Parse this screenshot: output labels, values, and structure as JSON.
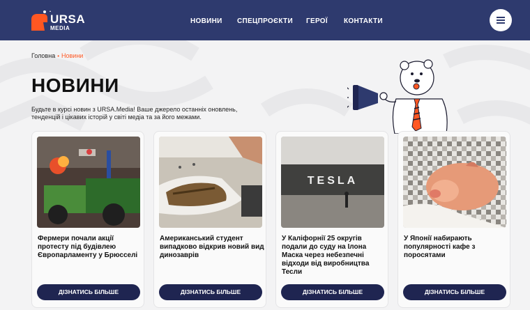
{
  "header": {
    "logo_text": "URSA",
    "logo_sub": "MEDIA",
    "nav": [
      "НОВИНИ",
      "СПЕЦПРОЄКТИ",
      "ГЕРОЇ",
      "КОНТАКТИ"
    ]
  },
  "breadcrumb": {
    "home": "Головна",
    "separator": "•",
    "current": "Новини"
  },
  "page": {
    "title": "НОВИНИ",
    "intro": "Будьте в курсі новин з URSA.Media! Ваше джерело останніх оновлень, тенденцій і цікавих історій у світі медіа та за його межами."
  },
  "cards": [
    {
      "title": "Фермери почали акції протесту під будівлею Європарламенту у Брюсселі",
      "button": "ДІЗНАТИСЬ БІЛЬШЕ"
    },
    {
      "title": "Американський студент випадково відкрив новий вид динозаврів",
      "button": "ДІЗНАТИСЬ БІЛЬШЕ"
    },
    {
      "title": "У Каліфорнії 25 округів подали до суду на Ілона Маска через небезпечні відходи від виробництва Тесли",
      "button": "ДІЗНАТИСЬ БІЛЬШЕ",
      "image_text": "TESLA"
    },
    {
      "title": "У Японії набирають популярності кафе з поросятами",
      "button": "ДІЗНАТИСЬ БІЛЬШЕ"
    }
  ],
  "colors": {
    "header_bg": "#2e3a6e",
    "accent": "#ff5722",
    "button_bg": "#1f2551",
    "page_bg": "#f3f3f4"
  },
  "icons": [
    "ursa-logo-icon",
    "hamburger-menu-icon",
    "bear-mascot-megaphone-icon"
  ]
}
